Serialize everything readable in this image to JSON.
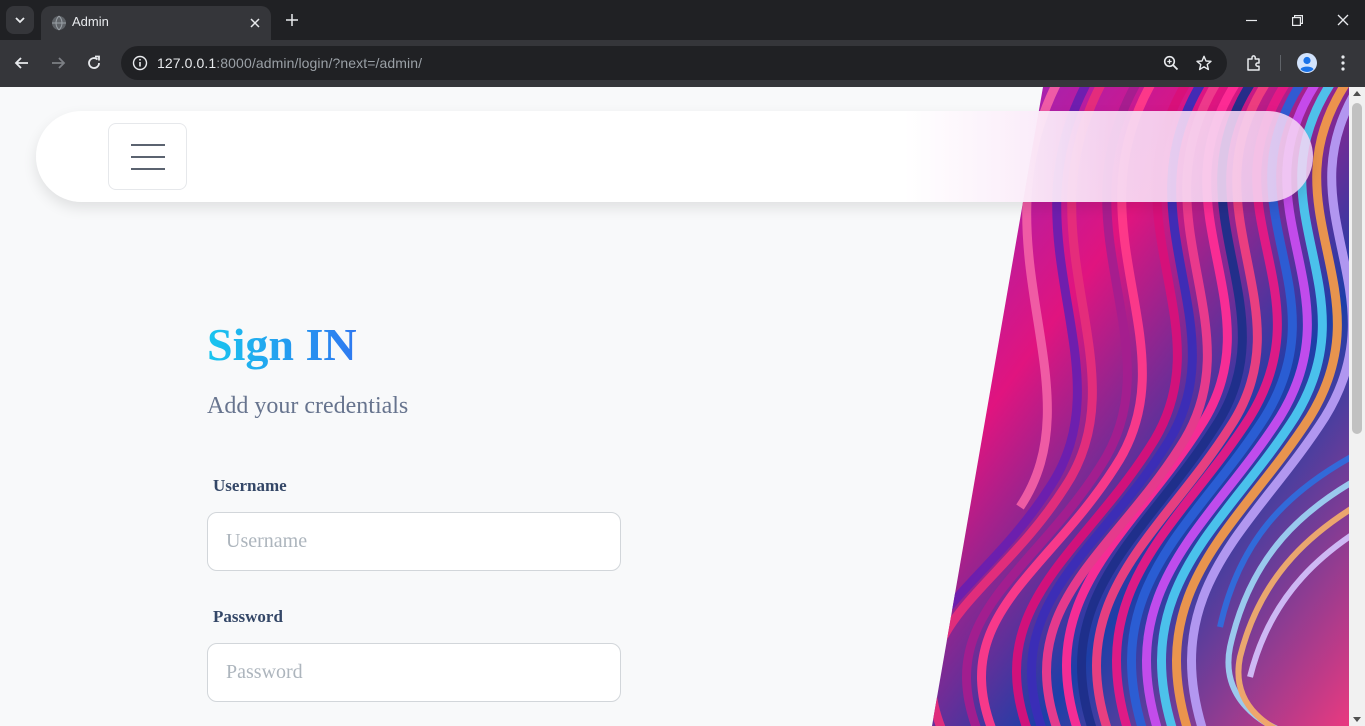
{
  "browser": {
    "tab_title": "Admin",
    "url_host": "127.0.0.1",
    "url_rest": ":8000/admin/login/?next=/admin/"
  },
  "page": {
    "title": "Sign IN",
    "subtitle": "Add your credentials",
    "username_label": "Username",
    "username_placeholder": "Username",
    "password_label": "Password",
    "password_placeholder": "Password"
  },
  "colors": {
    "title_gradient_start": "#19c6ef",
    "title_gradient_end": "#2f78f0",
    "label": "#344767",
    "subtitle": "#67748e"
  },
  "icons": {
    "tab_search": "chevron-down-icon",
    "tab_close": "close-icon",
    "new_tab": "plus-icon",
    "back": "arrow-left-icon",
    "forward": "arrow-right-icon",
    "reload": "reload-icon",
    "site_info": "info-icon",
    "zoom": "zoom-icon",
    "bookmark": "star-icon",
    "extensions": "puzzle-icon",
    "profile": "profile-icon",
    "menu": "kebab-menu-icon",
    "hamburger": "hamburger-icon"
  }
}
